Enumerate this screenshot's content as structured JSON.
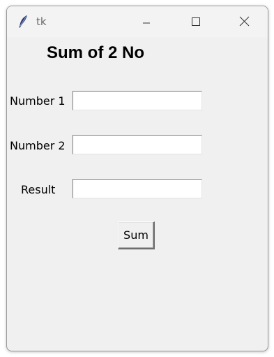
{
  "window": {
    "title": "tk",
    "controls": {
      "minimize_icon": "minimize-icon",
      "maximize_icon": "maximize-icon",
      "close_icon": "close-icon"
    }
  },
  "form": {
    "heading": "Sum of 2 No",
    "fields": [
      {
        "label": "Number 1",
        "value": ""
      },
      {
        "label": "Number 2",
        "value": ""
      },
      {
        "label": "Result",
        "value": ""
      }
    ],
    "button_label": "Sum"
  },
  "colors": {
    "window_bg": "#f0f0f0",
    "entry_bg": "#ffffff",
    "app_icon": "#2d3b6b"
  }
}
